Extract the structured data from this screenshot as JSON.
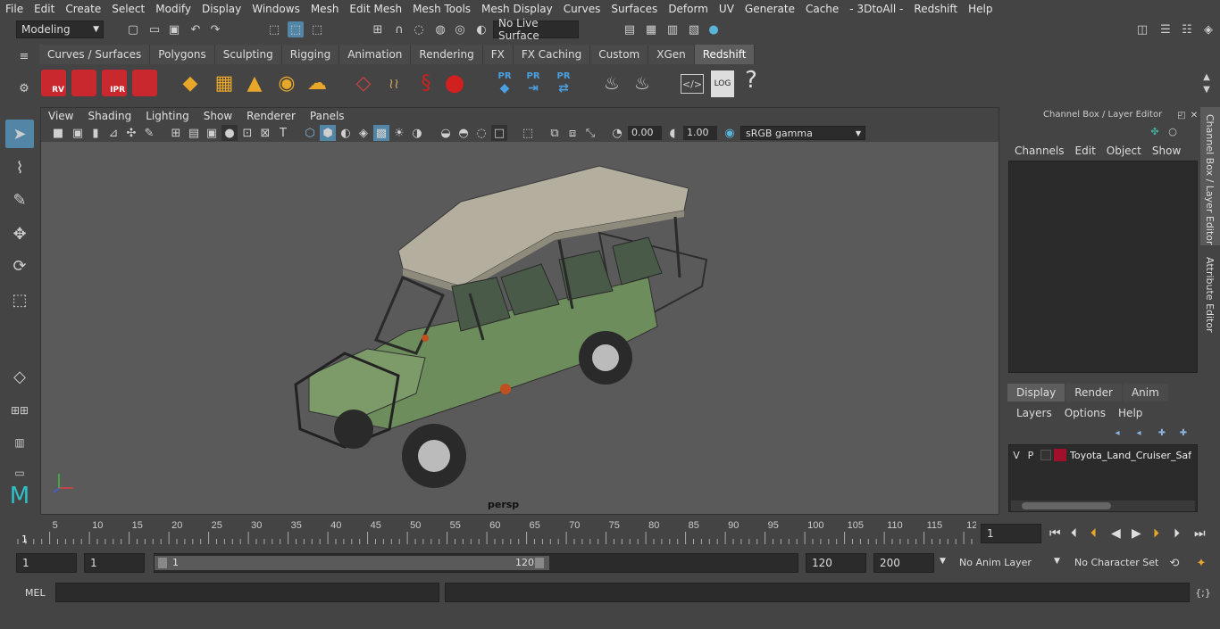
{
  "menubar": {
    "items": [
      "File",
      "Edit",
      "Create",
      "Select",
      "Modify",
      "Display",
      "Windows",
      "Mesh",
      "Edit Mesh",
      "Mesh Tools",
      "Mesh Display",
      "Curves",
      "Surfaces",
      "Deform",
      "UV",
      "Generate",
      "Cache",
      "- 3DtoAll -",
      "Redshift",
      "Help"
    ]
  },
  "statusline": {
    "mode": "Modeling",
    "live_surface": "No Live Surface"
  },
  "shelf": {
    "tabs": [
      "Curves / Surfaces",
      "Polygons",
      "Sculpting",
      "Rigging",
      "Animation",
      "Rendering",
      "FX",
      "FX Caching",
      "Custom",
      "XGen",
      "Redshift"
    ],
    "active_tab": "Redshift",
    "icons": {
      "rv": "RV",
      "ipr": "IPR",
      "pr": "PR",
      "log": "LOG",
      "help": "?"
    }
  },
  "viewport": {
    "menu": [
      "View",
      "Shading",
      "Lighting",
      "Show",
      "Renderer",
      "Panels"
    ],
    "exposure": "0.00",
    "gamma": "1.00",
    "colorspace": "sRGB gamma",
    "camera_label": "persp"
  },
  "channel_box": {
    "title": "Channel Box / Layer Editor",
    "menu": [
      "Channels",
      "Edit",
      "Object",
      "Show"
    ]
  },
  "layer_editor": {
    "tabs": [
      "Display",
      "Render",
      "Anim"
    ],
    "active_tab": "Display",
    "menu": [
      "Layers",
      "Options",
      "Help"
    ],
    "layers": [
      {
        "v": "V",
        "p": "P",
        "color": "#a0102a",
        "name": "Toyota_Land_Cruiser_Safari"
      }
    ]
  },
  "side_tabs": [
    "Channel Box / Layer Editor",
    "Attribute Editor"
  ],
  "timeline": {
    "ticks": [
      "5",
      "10",
      "15",
      "20",
      "25",
      "30",
      "35",
      "40",
      "45",
      "50",
      "55",
      "60",
      "65",
      "70",
      "75",
      "80",
      "85",
      "90",
      "95",
      "100",
      "105",
      "110",
      "115",
      "12"
    ],
    "current_marker": "1",
    "current_frame": "1"
  },
  "range": {
    "start": "1",
    "anim_start": "1",
    "slider_start": "1",
    "slider_end": "120",
    "playback_end": "120",
    "anim_end": "200",
    "anim_layer": "No Anim Layer",
    "character_set": "No Character Set"
  },
  "mel": {
    "label": "MEL"
  },
  "colors": {
    "bg": "#444444",
    "viewport_bg": "#5a5a5a",
    "accent": "#5285a6",
    "redshift_red": "#c8282e",
    "orange": "#e9a72a"
  }
}
